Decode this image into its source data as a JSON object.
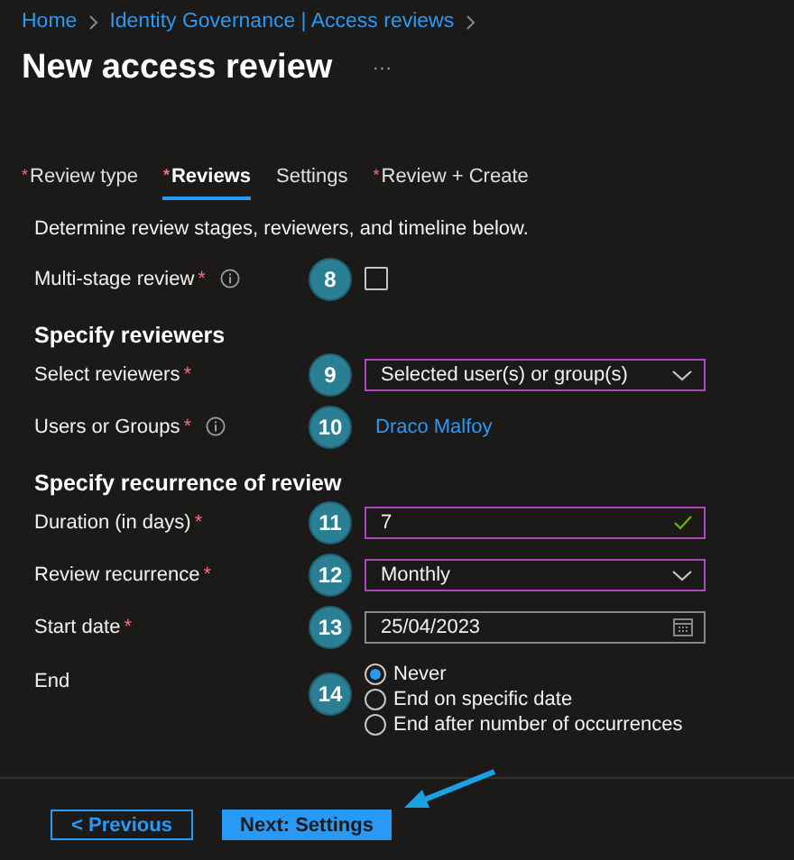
{
  "breadcrumb": [
    {
      "label": "Home"
    },
    {
      "label": "Identity Governance | Access reviews"
    }
  ],
  "title": "New access review",
  "more": "···",
  "tabs": [
    {
      "label": "Review type",
      "required_mark": "*",
      "selected": false
    },
    {
      "label": "Reviews",
      "required_mark": "*",
      "selected": true
    },
    {
      "label": "Settings",
      "selected": false
    },
    {
      "label": "Review + Create",
      "required_mark": "*",
      "selected": false
    }
  ],
  "description": "Determine review stages, reviewers, and timeline below.",
  "sections": [
    {
      "rows": [
        {
          "kind": "checkbox",
          "label": "Multi-stage review",
          "required_mark": "*",
          "info": true,
          "step": "8",
          "checked": false
        }
      ]
    },
    {
      "heading": "Specify reviewers",
      "rows": [
        {
          "kind": "dropdown",
          "label": "Select reviewers",
          "required_mark": "*",
          "info": false,
          "step": "9",
          "value": "Selected user(s) or group(s)",
          "highlighted": true
        },
        {
          "kind": "link",
          "label": "Users or Groups",
          "required_mark": "*",
          "info": true,
          "step": "10",
          "value": "Draco Malfoy"
        }
      ]
    },
    {
      "heading": "Specify recurrence of review",
      "rows": [
        {
          "kind": "text",
          "label": "Duration (in days)",
          "required_mark": "*",
          "info": false,
          "step": "11",
          "value": "7",
          "highlighted": true,
          "valid": true
        },
        {
          "kind": "dropdown",
          "label": "Review recurrence",
          "required_mark": "*",
          "info": false,
          "step": "12",
          "value": "Monthly",
          "highlighted": true
        },
        {
          "kind": "date",
          "label": "Start date",
          "required_mark": "*",
          "info": false,
          "step": "13",
          "value": "25/04/2023",
          "highlighted": false
        },
        {
          "kind": "radio",
          "label": "End",
          "info": false,
          "step": "14",
          "options": [
            {
              "label": "Never",
              "selected": true
            },
            {
              "label": "End on specific date",
              "selected": false
            },
            {
              "label": "End after number of occurrences",
              "selected": false
            }
          ]
        }
      ]
    }
  ],
  "footer": {
    "previous": "< Previous",
    "next": "Next: Settings"
  }
}
